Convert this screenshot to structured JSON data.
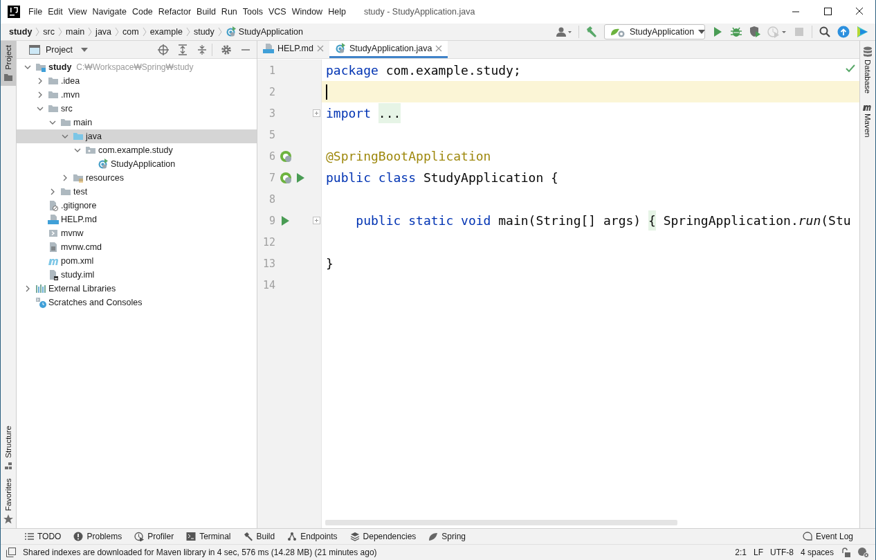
{
  "window": {
    "title": "study - StudyApplication.java"
  },
  "menu": [
    "File",
    "Edit",
    "View",
    "Navigate",
    "Code",
    "Refactor",
    "Build",
    "Run",
    "Tools",
    "VCS",
    "Window",
    "Help"
  ],
  "breadcrumbs": [
    {
      "label": "study",
      "kind": "project"
    },
    {
      "label": "src",
      "kind": "plain"
    },
    {
      "label": "main",
      "kind": "plain"
    },
    {
      "label": "java",
      "kind": "plain"
    },
    {
      "label": "com",
      "kind": "plain"
    },
    {
      "label": "example",
      "kind": "plain"
    },
    {
      "label": "study",
      "kind": "plain"
    },
    {
      "label": "StudyApplication",
      "kind": "class"
    }
  ],
  "run_config": "StudyApplication",
  "left_tool_tabs": [
    {
      "label": "Project",
      "selected": true,
      "kind": "folder"
    },
    {
      "label": "Structure",
      "selected": false,
      "kind": "structure"
    },
    {
      "label": "Favorites",
      "selected": false,
      "kind": "star"
    }
  ],
  "project_panel": {
    "title": "Project",
    "tree": [
      {
        "label": "study",
        "path": "C:₩Workspace₩Spring₩study",
        "kind": "module",
        "expanded": true,
        "selected": false,
        "children": [
          {
            "label": ".idea",
            "kind": "folder",
            "expanded": false,
            "selected": false
          },
          {
            "label": ".mvn",
            "kind": "folder",
            "expanded": false,
            "selected": false
          },
          {
            "label": "src",
            "kind": "folder",
            "expanded": true,
            "selected": false,
            "children": [
              {
                "label": "main",
                "kind": "folder",
                "expanded": true,
                "selected": false,
                "children": [
                  {
                    "label": "java",
                    "kind": "source",
                    "expanded": true,
                    "selected": true,
                    "children": [
                      {
                        "label": "com.example.study",
                        "kind": "package",
                        "expanded": true,
                        "selected": false,
                        "children": [
                          {
                            "label": "StudyApplication",
                            "kind": "class",
                            "selected": false
                          }
                        ]
                      }
                    ]
                  },
                  {
                    "label": "resources",
                    "kind": "resources",
                    "expanded": false,
                    "selected": false
                  }
                ]
              },
              {
                "label": "test",
                "kind": "folder",
                "expanded": false,
                "selected": false
              }
            ]
          },
          {
            "label": ".gitignore",
            "kind": "ignore",
            "selected": false
          },
          {
            "label": "HELP.md",
            "kind": "md",
            "selected": false
          },
          {
            "label": "mvnw",
            "kind": "script",
            "selected": false
          },
          {
            "label": "mvnw.cmd",
            "kind": "text",
            "selected": false
          },
          {
            "label": "pom.xml",
            "kind": "maven",
            "selected": false
          },
          {
            "label": "study.iml",
            "kind": "iml",
            "selected": false
          }
        ]
      },
      {
        "label": "External Libraries",
        "kind": "libraries",
        "expanded": false,
        "selected": false
      },
      {
        "label": "Scratches and Consoles",
        "kind": "scratches",
        "selected": false
      }
    ]
  },
  "editor": {
    "tabs": [
      {
        "label": "HELP.md",
        "kind": "md",
        "selected": false
      },
      {
        "label": "StudyApplication.java",
        "kind": "class",
        "selected": true
      }
    ],
    "lines": [
      {
        "number": "1",
        "current": false,
        "tokens": [
          {
            "text": "package",
            "kind": "keyword"
          },
          {
            "text": " com.example.study;",
            "kind": "plain"
          }
        ]
      },
      {
        "number": "2",
        "current": true
      },
      {
        "number": "3",
        "current": false,
        "fold": true,
        "tokens": [
          {
            "text": "import",
            "kind": "keyword"
          },
          {
            "text": "...",
            "kind": "folded"
          }
        ]
      },
      {
        "number": "5",
        "current": false
      },
      {
        "number": "6",
        "current": false,
        "gutter": [
          {
            "kind": "bean"
          }
        ],
        "tokens": [
          {
            "text": "@SpringBootApplication",
            "kind": "annotation"
          }
        ]
      },
      {
        "number": "7",
        "current": false,
        "gutter": [
          {
            "kind": "bean"
          },
          {
            "kind": "run"
          }
        ],
        "tokens": [
          {
            "text": "public class",
            "kind": "keyword"
          },
          {
            "text": " StudyApplication {",
            "kind": "plain"
          }
        ]
      },
      {
        "number": "8",
        "current": false
      },
      {
        "number": "9",
        "current": false,
        "fold": true,
        "gutter": [
          {
            "kind": "run"
          }
        ],
        "tokens": [
          {
            "text": "    public static void",
            "kind": "keyword"
          },
          {
            "text": " main(String[] args) ",
            "kind": "plain"
          },
          {
            "text": "{",
            "kind": "folded"
          },
          {
            "text": " SpringApplication.",
            "kind": "plain"
          },
          {
            "text": "run",
            "kind": "italic"
          },
          {
            "text": "(Stu",
            "kind": "plain"
          }
        ]
      },
      {
        "number": "12",
        "current": false
      },
      {
        "number": "13",
        "current": false,
        "tokens": [
          {
            "text": "}",
            "kind": "plain"
          }
        ]
      },
      {
        "number": "14",
        "current": false
      }
    ]
  },
  "right_tool_tabs": [
    {
      "label": "Database",
      "kind": "database"
    },
    {
      "label": "Maven",
      "kind": "maven"
    }
  ],
  "bottom_tools": [
    {
      "label": "TODO",
      "kind": "list"
    },
    {
      "label": "Problems",
      "kind": "problems"
    },
    {
      "label": "Profiler",
      "kind": "profiler"
    },
    {
      "label": "Terminal",
      "kind": "terminal"
    },
    {
      "label": "Build",
      "kind": "hammer"
    },
    {
      "label": "Endpoints",
      "kind": "endpoints"
    },
    {
      "label": "Dependencies",
      "kind": "layers"
    },
    {
      "label": "Spring",
      "kind": "leaf"
    }
  ],
  "event_log": "Event Log",
  "status_bar": {
    "message": "Shared indexes are downloaded for Maven library in 4 sec, 576 ms (14.28 MB) (21 minutes ago)",
    "items": [
      "2:1",
      "LF",
      "UTF-8",
      "4 spaces"
    ]
  }
}
